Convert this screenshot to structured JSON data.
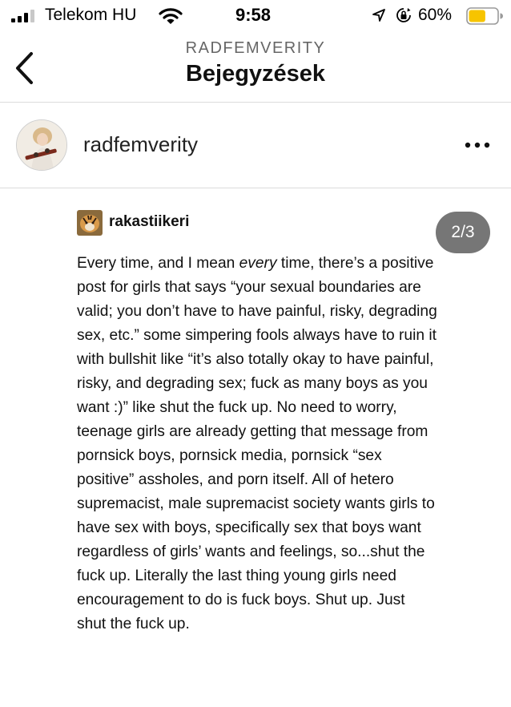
{
  "status_bar": {
    "carrier": "Telekom HU",
    "time": "9:58",
    "battery": "60%",
    "battery_level": 0.6,
    "battery_color": "#f7c400"
  },
  "nav": {
    "back_icon": "chevron-left-icon",
    "blog_label": "RADFEMVERITY",
    "title": "Bejegyzések"
  },
  "blog": {
    "name": "radfemverity",
    "more_icon": "ellipsis-icon"
  },
  "post": {
    "reblog_author": "rakastiikeri",
    "page_indicator": "2/3",
    "text_before_em": "Every time, and I mean ",
    "text_em": "every",
    "text_after_em": " time, there’s a positive post for girls that says “your sexual boundaries are valid; you don’t have to have painful, risky, degrading sex, etc.” some simpering fools always have to ruin it with bullshit like “it’s also totally okay to have painful, risky, and degrading sex; fuck as many boys as you want :)” like shut the fuck up. No need to worry, teenage girls are already getting that message from pornsick boys, pornsick media, pornsick “sex positive” assholes, and porn itself. All of hetero supremacist, male supremacist society wants girls to have sex with boys, specifically sex that boys want regardless of girls’ wants and feelings, so...shut the fuck up. Literally the last thing young girls need encouragement to do is fuck boys. Shut up. Just shut the fuck up."
  }
}
